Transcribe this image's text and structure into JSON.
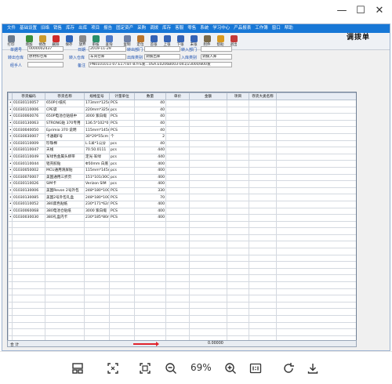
{
  "window": {
    "minimize": "—",
    "maximize": "☐",
    "close": "✕"
  },
  "menu": [
    "文件",
    "基础设置",
    "旧络",
    "销售",
    "库存",
    "出库",
    "项目",
    "报告",
    "固定资产",
    "采购",
    "调拨",
    "库存",
    "客服",
    "零售",
    "系统",
    "学习中心",
    "产品报表",
    "工作簿",
    "窗口",
    "帮助"
  ],
  "toolbar": [
    {
      "label": "打印",
      "icon": "printer-icon",
      "color": "#6b7a8c"
    },
    {
      "label": "增加",
      "icon": "add-icon",
      "color": "#3a8e3a"
    },
    {
      "label": "修改",
      "icon": "edit-icon",
      "color": "#c99a2e"
    },
    {
      "label": "删除",
      "icon": "delete-icon",
      "color": "#cf2b2b"
    },
    {
      "label": "保存",
      "icon": "save-icon",
      "color": "#2f64b8"
    },
    {
      "label": "放弃",
      "icon": "cancel-icon",
      "color": "#8a8a8a"
    },
    {
      "label": "审核",
      "icon": "check-icon",
      "color": "#2a8f6a"
    },
    {
      "label": "查询",
      "icon": "search-icon",
      "color": "#4d79c7"
    },
    {
      "label": "复制",
      "icon": "copy-icon",
      "color": "#6e7fa3"
    },
    {
      "label": "定位",
      "icon": "locate-icon",
      "color": "#b8742c"
    },
    {
      "label": "首张",
      "icon": "first-icon",
      "color": "#3563b5"
    },
    {
      "label": "上张",
      "icon": "prev-icon",
      "color": "#3563b5"
    },
    {
      "label": "下张",
      "icon": "next-icon",
      "color": "#3563b5"
    },
    {
      "label": "末张",
      "icon": "last-icon",
      "color": "#3563b5"
    },
    {
      "label": "附件",
      "icon": "attach-icon",
      "color": "#7a6a4a"
    },
    {
      "label": "帮助",
      "icon": "help-icon",
      "color": "#d89a20"
    },
    {
      "label": "退出",
      "icon": "exit-icon",
      "color": "#c23a3a"
    }
  ],
  "doc_title": "调拨单",
  "form": {
    "bill_no_label": "单据号",
    "bill_no": "0000002437",
    "date_label": "日期",
    "date": "2019-11-29",
    "out_dept_label": "转出部门",
    "out_dept": "",
    "in_dept_label": "转入部门",
    "in_dept": "",
    "out_wh_label": "转出仓库",
    "out_wh": "原材料仓库",
    "in_wh_label": "转入仓库",
    "in_wh": "车间仓库",
    "out_type_label": "出库类别",
    "out_type": "调拨出库",
    "in_type_label": "入库类别",
    "in_type": "调拨入库",
    "handler_label": "经手人",
    "handler": "",
    "note_label": "备注",
    "note": "PN0101011-07.E17TBT-87FS发...USA.E0206B003-041/23000/800发"
  },
  "grid": {
    "headers": [
      "存货编码",
      "存货名称",
      "规格型号",
      "计量单位",
      "数量",
      "单价",
      "金额",
      "项目",
      "存货大类名称"
    ],
    "rows": [
      [
        "01030110057",
        "650P小纸托",
        "173mm*125mm",
        "PCS",
        "40"
      ],
      [
        "01030110006",
        "CPE袋",
        "220mm*325mm",
        "pcs",
        "40"
      ],
      [
        "01030060076",
        "650P电池仓贴纸中",
        "3000 紫白缎",
        "PCS",
        "40"
      ],
      [
        "01030130063",
        "STRONG贴 370专用",
        "136.5*102*0",
        "PCS",
        "40"
      ],
      [
        "01030040050",
        "Eprimio 370 说明",
        "115mm*145mm",
        "PCS",
        "40"
      ],
      [
        "01030030007",
        "卡通箱F号",
        "30*29*55cm",
        "个",
        "2"
      ],
      [
        "01030110009",
        "珍珠棉",
        "L:1米*1公分",
        "pcs",
        "40"
      ],
      [
        "01030110047",
        "天线",
        "70.50.0111",
        "pcs",
        "440"
      ],
      [
        "01030110049",
        "军绿色金属头绑带",
        "定光·军绿",
        "pcs",
        "440"
      ],
      [
        "01030110044",
        "铝壳胶贴",
        "Φ50mm 白底",
        "pcs",
        "400"
      ],
      [
        "01030050002",
        "MCU通用滑屏贴",
        "115mm*145mm",
        "pcs",
        "400"
      ],
      [
        "01030070007",
        "美国通用三折页",
        "151*101/30C",
        "pcs",
        "400"
      ],
      [
        "01030110026",
        "SIM卡",
        "Verizon SIM",
        "pcs",
        "400"
      ],
      [
        "01030130006",
        "美国Revon 2号外包",
        "248*180*100",
        "PCS",
        "330"
      ],
      [
        "01030130085",
        "美国2号外包礼盒",
        "248*180*100",
        "PCS",
        "70"
      ],
      [
        "01030110052",
        "380黑色贴纸",
        "230*171*62/",
        "PCS",
        "400"
      ],
      [
        "01030060068",
        "380电池仓贴纸",
        "3000 紫白缎",
        "PCS",
        "400"
      ],
      [
        "01030030030",
        "380礼盒内卡",
        "230*185*80m",
        "PCS",
        "400"
      ]
    ],
    "empty_rows": 18
  },
  "summary": {
    "label": "合  计",
    "amount": "0.00000"
  },
  "viewer": {
    "zoom": "69%"
  }
}
